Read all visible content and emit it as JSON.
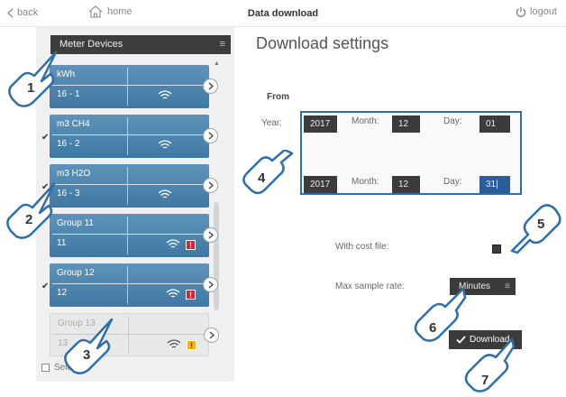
{
  "topbar": {
    "back_label": "back",
    "home_label": "home",
    "title": "Data download",
    "logout_label": "logout"
  },
  "sidebar": {
    "header": "Meter Devices",
    "devices": [
      {
        "name": "kWh",
        "id": "16 - 1",
        "checked": false,
        "alarm": ""
      },
      {
        "name": "m3 CH4",
        "id": "16 - 2",
        "checked": true,
        "alarm": ""
      },
      {
        "name": "m3 H2O",
        "id": "16 - 3",
        "checked": true,
        "alarm": ""
      },
      {
        "name": "Group 11",
        "id": "11",
        "checked": false,
        "alarm": "!"
      },
      {
        "name": "Group 12",
        "id": "12",
        "checked": true,
        "alarm": "!"
      },
      {
        "name": "Group 13",
        "id": "13",
        "checked": false,
        "alarm": "!"
      }
    ],
    "select_all_label": "Select All",
    "check_mark": "✔"
  },
  "main": {
    "heading": "Download settings",
    "from_label": "From",
    "year_label": "Year:",
    "month_label": "Month:",
    "day_label": "Day:",
    "from_date": {
      "year": "2017",
      "month": "12",
      "day": "01"
    },
    "to_date": {
      "year": "2017",
      "month": "12",
      "day": "31|"
    },
    "cost_file_label": "With cost file:",
    "sample_rate_label": "Max sample rate:",
    "sample_rate_value": "Minutes",
    "download_label": "Download"
  },
  "markers": [
    "1",
    "2",
    "3",
    "4",
    "5",
    "6",
    "7"
  ],
  "colors": {
    "device_blue": "#4a84ad",
    "frame_blue": "#2f6ea6",
    "alarm_red": "#d0263b",
    "alarm_yellow": "#f2b316",
    "field_dark": "#3b3b3b"
  }
}
